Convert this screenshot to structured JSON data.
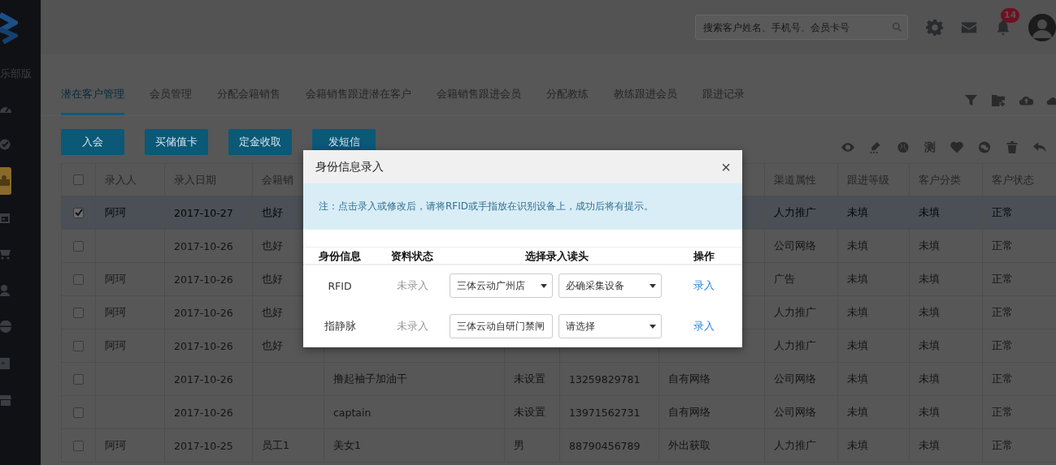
{
  "sidebar": {
    "brand_text": "乐部版",
    "items": [
      {
        "kind": "gauge",
        "selected": false
      },
      {
        "kind": "check",
        "selected": false
      },
      {
        "kind": "card",
        "selected": true
      },
      {
        "kind": "calendar",
        "selected": false
      },
      {
        "kind": "cart",
        "selected": false
      },
      {
        "kind": "user",
        "selected": false
      },
      {
        "kind": "pie",
        "selected": false
      },
      {
        "kind": "calc",
        "selected": false
      },
      {
        "kind": "store",
        "selected": false
      }
    ]
  },
  "header": {
    "search": {
      "placeholder": "搜索客户姓名、手机号、会员卡号"
    },
    "notification_count": "14"
  },
  "tabs": [
    {
      "label": "潜在客户管理",
      "selected": true
    },
    {
      "label": "会员管理",
      "selected": false
    },
    {
      "label": "分配会籍销售",
      "selected": false
    },
    {
      "label": "会籍销售跟进潜在客户",
      "selected": false
    },
    {
      "label": "会籍销售跟进会员",
      "selected": false
    },
    {
      "label": "分配教练",
      "selected": false
    },
    {
      "label": "教练跟进会员",
      "selected": false
    },
    {
      "label": "跟进记录",
      "selected": false
    }
  ],
  "buttons": [
    "入会",
    "买储值卡",
    "定金收取",
    "发短信"
  ],
  "tool_label": "测",
  "table": {
    "all_checked": false,
    "columns": [
      "录入人",
      "录入日期",
      "会籍销",
      null,
      null,
      null,
      null,
      "渠道属性",
      "跟进等级",
      "客户分类",
      "客户状态"
    ],
    "rows": [
      {
        "checked": true,
        "selected": true,
        "cells": [
          "阿珂",
          "2017-10-27",
          "也好",
          null,
          null,
          null,
          null,
          "人力推广",
          "未填",
          "未填",
          "正常"
        ]
      },
      {
        "checked": false,
        "selected": false,
        "cells": [
          null,
          "2017-10-26",
          "也好",
          null,
          null,
          null,
          null,
          "公司网络",
          "未填",
          "未填",
          "正常"
        ]
      },
      {
        "checked": false,
        "selected": false,
        "cells": [
          "阿珂",
          "2017-10-26",
          "也好",
          null,
          null,
          null,
          null,
          "广告",
          "未填",
          "未填",
          "正常"
        ]
      },
      {
        "checked": false,
        "selected": false,
        "cells": [
          "阿珂",
          "2017-10-26",
          "也好",
          null,
          null,
          null,
          null,
          "人力推广",
          "未填",
          "未填",
          "正常"
        ]
      },
      {
        "checked": false,
        "selected": false,
        "cells": [
          "阿珂",
          "2017-10-26",
          "也好",
          null,
          null,
          null,
          null,
          "人力推广",
          "未填",
          "未填",
          "正常"
        ]
      },
      {
        "checked": false,
        "selected": false,
        "cells": [
          null,
          "2017-10-26",
          null,
          "撸起袖子加油干",
          "未设置",
          "13259829781",
          "自有网络",
          "公司网络",
          "未填",
          "未填",
          "正常"
        ]
      },
      {
        "checked": false,
        "selected": false,
        "cells": [
          null,
          "2017-10-26",
          null,
          "captain",
          "未设置",
          "13971562731",
          "自有网络",
          "公司网络",
          "未填",
          "未填",
          "正常"
        ]
      },
      {
        "checked": false,
        "selected": false,
        "cells": [
          "阿珂",
          "2017-10-25",
          "员工1",
          "美女1",
          "男",
          "88790456789",
          "外出获取",
          "人力推广",
          "未填",
          "未填",
          "正常"
        ]
      }
    ]
  },
  "modal": {
    "title": "身份信息录入",
    "close": "×",
    "notice": "注：点击录入或修改后，请将RFID或手指放在识别设备上，成功后将有提示。",
    "columns": [
      "身份信息",
      "资料状态",
      "选择录入读头",
      "操作"
    ],
    "rows": [
      {
        "name": "RFID",
        "status": "未录入",
        "store": "三体云动广州店",
        "device": "必确采集设备",
        "action": "录入"
      },
      {
        "name": "指静脉",
        "status": "未录入",
        "store": "三体云动自研门禁闸",
        "device": "请选择",
        "action": "录入"
      }
    ]
  }
}
